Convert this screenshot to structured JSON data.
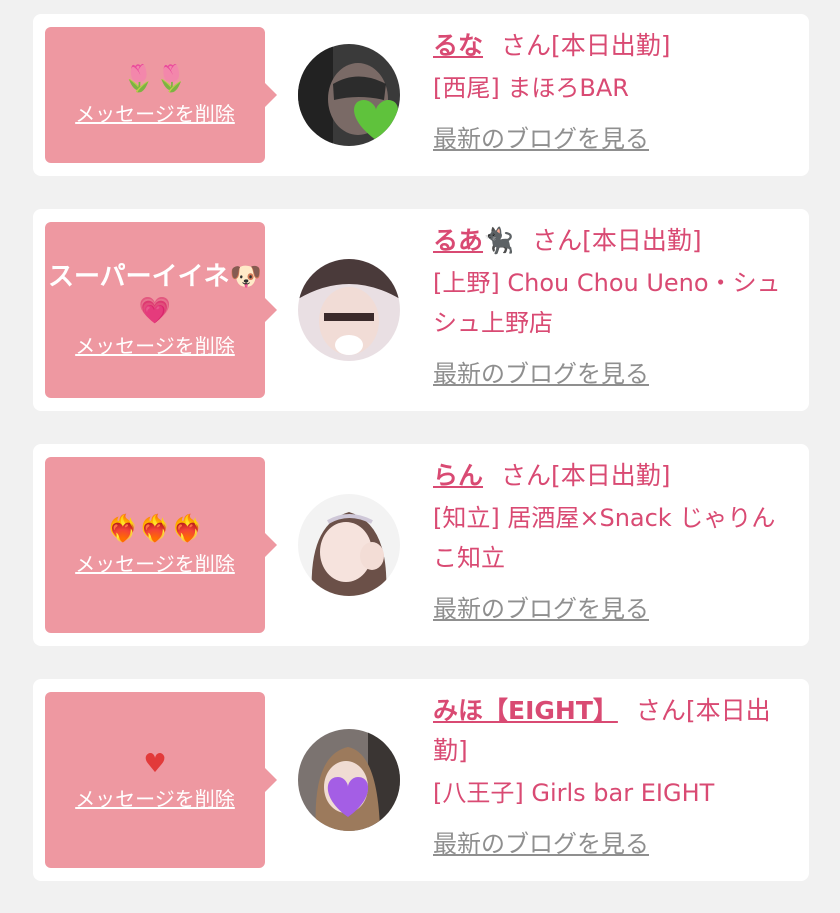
{
  "cards": [
    {
      "message": "",
      "emoji": "🌷🌷",
      "delete_label": "メッセージを削除",
      "name": "るな",
      "name_suffix": "",
      "status": "さん[本日出勤]",
      "shop": "[西尾] まほろBAR",
      "blog_label": "最新のブログを見る"
    },
    {
      "message": "スーパーイイネ🐶",
      "emoji": "💗",
      "delete_label": "メッセージを削除",
      "name": "るあ",
      "name_suffix": "🐈‍⬛",
      "status": "さん[本日出勤]",
      "shop": "[上野] Chou Chou Ueno・シュシュ上野店",
      "blog_label": "最新のブログを見る"
    },
    {
      "message": "",
      "emoji": "❤️‍🔥❤️‍🔥❤️‍🔥",
      "delete_label": "メッセージを削除",
      "name": "らん",
      "name_suffix": "",
      "status": "さん[本日出勤]",
      "shop": "[知立] 居酒屋×Snack じゃりんこ知立",
      "blog_label": "最新のブログを見る"
    },
    {
      "message": "",
      "emoji": "♥",
      "delete_label": "メッセージを削除",
      "name": "みほ【EIGHT】",
      "name_suffix": "",
      "status": "さん[本日出勤]",
      "shop": "[八王子] Girls bar EIGHT",
      "blog_label": "最新のブログを見る"
    }
  ],
  "colors": {
    "accent": "#d94a73",
    "bubble": "#ee98a1",
    "link_gray": "#8f8f8f",
    "background": "#f1f1f1"
  }
}
